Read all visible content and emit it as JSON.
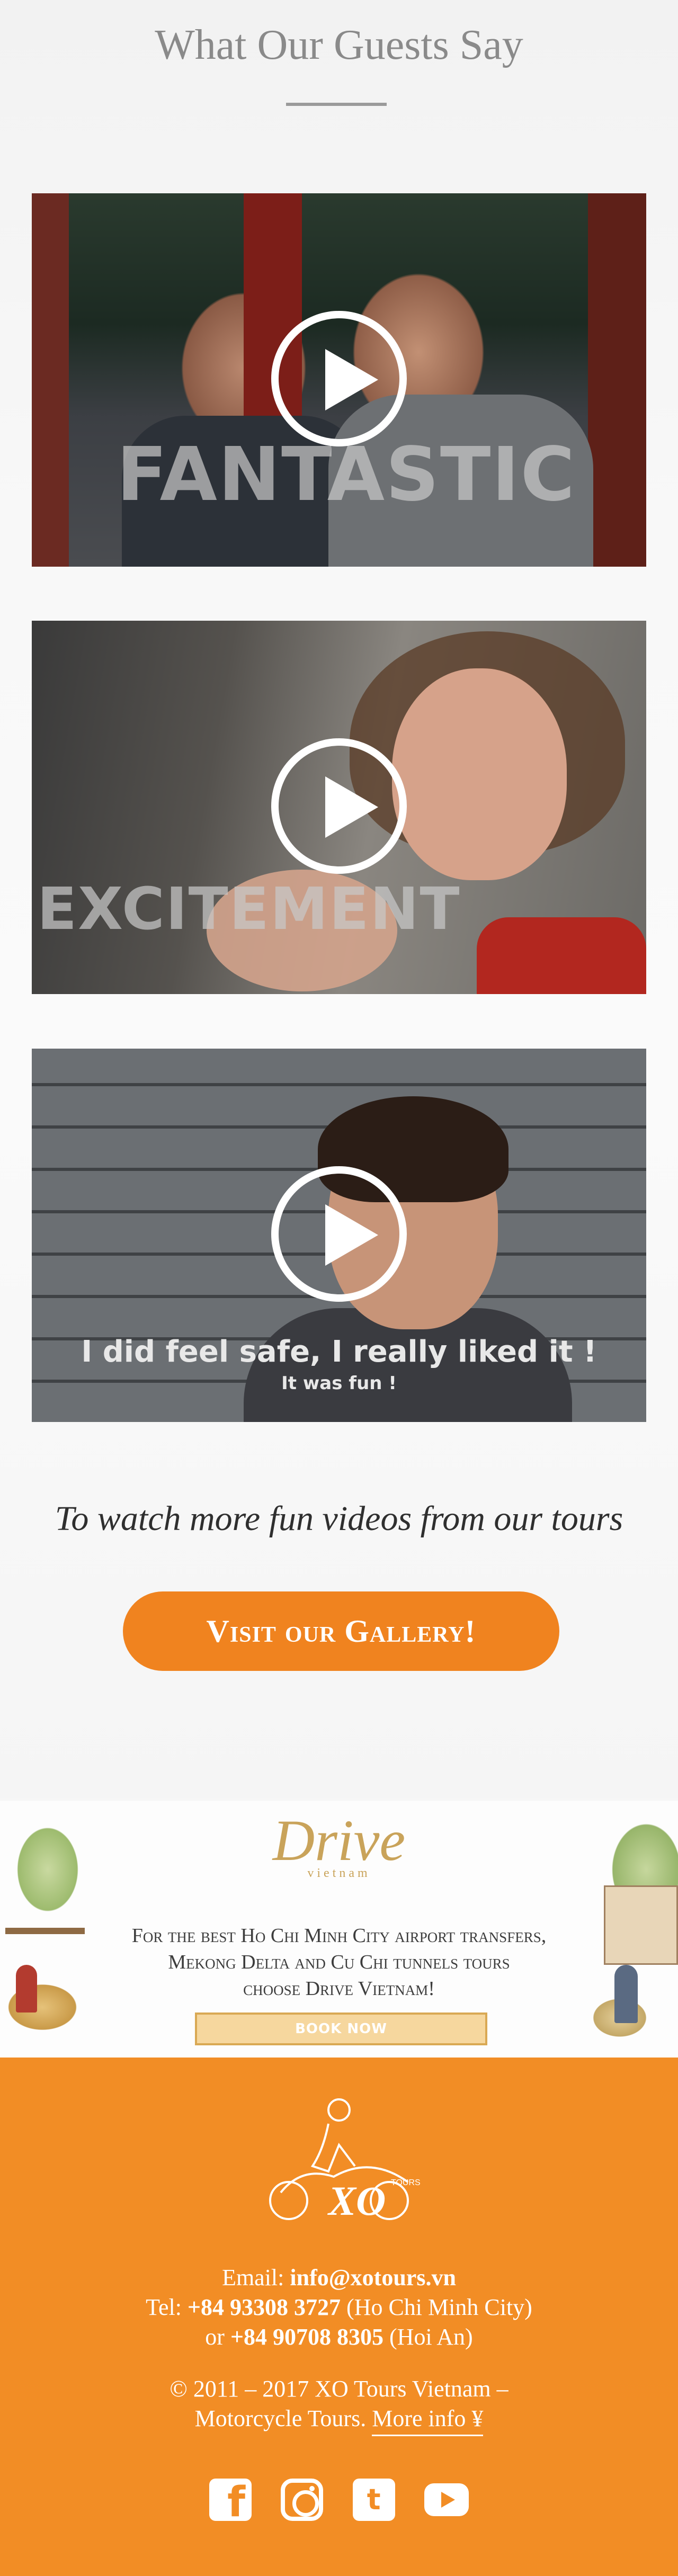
{
  "testimonials": {
    "title": "What Our Guests Say",
    "videos": [
      {
        "overlay": "FANTASTIC"
      },
      {
        "overlay": "EXCITEMENT"
      },
      {
        "caption_main": "I did feel safe, I really liked it !",
        "caption_sub": "It was fun !"
      }
    ],
    "more_videos_text": "To watch more fun videos from our tours",
    "gallery_button": "Visit our Gallery!"
  },
  "drive_banner": {
    "logo_text": "Drive",
    "logo_sub": "vietnam",
    "text_line1": "For the best Ho Chi Minh City airport transfers,",
    "text_line2": "Mekong Delta and Cu Chi tunnels tours",
    "text_line3": "choose Drive Vietnam!",
    "book_button": "BOOK NOW"
  },
  "footer": {
    "email_label": "Email: ",
    "email": "info@xotours.vn",
    "tel_label": "Tel: ",
    "phone1": "+84 93308 3727",
    "phone1_city": " (Ho Chi Minh City)",
    "or_label": "or ",
    "phone2": "+84 90708 8305",
    "phone2_city": " (Hoi An)",
    "copyright_line1": "© 2011 – 2017 XO Tours Vietnam –",
    "copyright_line2": "Motorcycle Tours. ",
    "more_info": "More info ¥",
    "logo_text": "XO",
    "logo_sub": "TOURS",
    "socials": [
      "facebook-icon",
      "instagram-icon",
      "twitter-icon",
      "youtube-icon"
    ],
    "facebook_glyph": "f",
    "twitter_glyph": "t"
  },
  "colors": {
    "accent": "#f0831f",
    "footer_bg": "#f28d25",
    "drive_gold": "#c9a35a"
  }
}
